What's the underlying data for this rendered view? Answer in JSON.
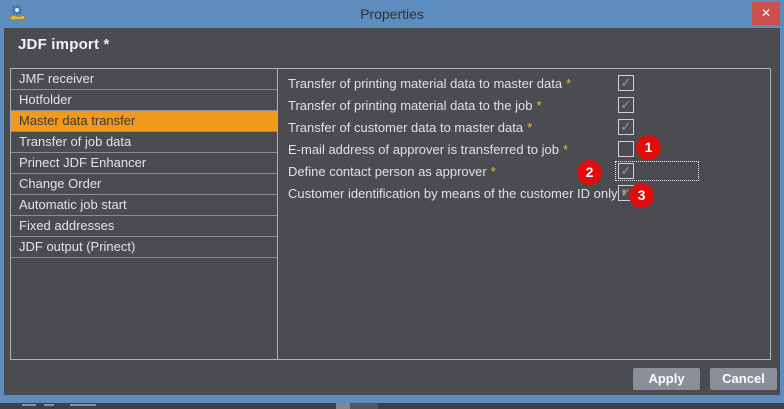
{
  "titlebar": {
    "title": "Properties",
    "close_label": "✕"
  },
  "header": {
    "title": "JDF import *"
  },
  "sidebar": {
    "items": [
      {
        "label": "JMF receiver",
        "selected": false
      },
      {
        "label": "Hotfolder",
        "selected": false
      },
      {
        "label": "Master data transfer",
        "selected": true
      },
      {
        "label": "Transfer of job data",
        "selected": false
      },
      {
        "label": "Prinect JDF Enhancer",
        "selected": false
      },
      {
        "label": "Change Order",
        "selected": false
      },
      {
        "label": "Automatic job start",
        "selected": false
      },
      {
        "label": "Fixed addresses",
        "selected": false
      },
      {
        "label": "JDF output (Prinect)",
        "selected": false
      }
    ]
  },
  "settings": {
    "check_glyph": "✓",
    "rows": [
      {
        "label": "Transfer of printing material data to master data",
        "asterisk": "*",
        "checked": true,
        "focused": false,
        "badge": null
      },
      {
        "label": "Transfer of printing material data to the job",
        "asterisk": "*",
        "checked": true,
        "focused": false,
        "badge": null
      },
      {
        "label": "Transfer of customer data to master data",
        "asterisk": "*",
        "checked": true,
        "focused": false,
        "badge": null
      },
      {
        "label": "E-mail address of approver is transferred to job",
        "asterisk": "*",
        "checked": false,
        "focused": false,
        "badge": {
          "text": "1",
          "pos": "right-high"
        }
      },
      {
        "label": "Define contact person as approver",
        "asterisk": "*",
        "checked": true,
        "focused": true,
        "badge": {
          "text": "2",
          "pos": "left"
        }
      },
      {
        "label": "Customer identification by means of the customer ID only",
        "asterisk": "*",
        "checked": true,
        "focused": false,
        "badge": {
          "text": "3",
          "pos": "right"
        }
      }
    ]
  },
  "footer": {
    "apply_label": "Apply",
    "cancel_label": "Cancel"
  },
  "colors": {
    "titlebar_blue": "#5d8cbf",
    "close_red": "#ca504e",
    "content_bg": "#4b4b52",
    "selected_orange": "#f0991c",
    "badge_red": "#e10c0c",
    "asterisk_gold": "#ecbf2e",
    "button_gray": "#8b8f97"
  }
}
